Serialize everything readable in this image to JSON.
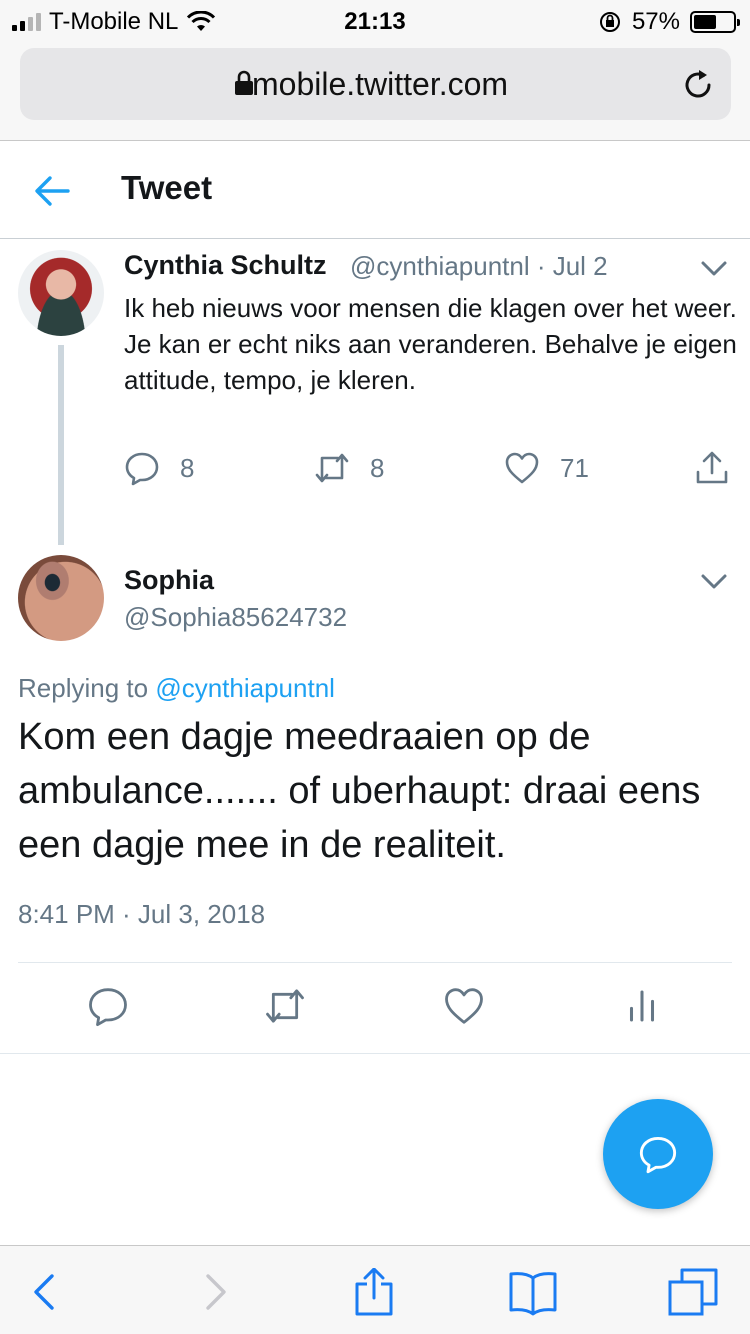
{
  "status_bar": {
    "carrier": "T-Mobile NL",
    "time": "21:13",
    "battery_percent": "57%",
    "battery_level": 0.57,
    "signal_bars": 4,
    "signal_bars_active": 2
  },
  "browser": {
    "url": "mobile.twitter.com"
  },
  "header": {
    "title": "Tweet"
  },
  "parent_tweet": {
    "author_name": "Cynthia Schultz",
    "handle_date": "@cynthiapuntnl · Jul 2",
    "text_line1": "Ik heb nieuws voor mensen die klagen over het weer.",
    "text_line2": "Je kan er echt niks aan veranderen.  Behalve je eigen attitude, tempo, je kleren.",
    "replies": "8",
    "retweets": "8",
    "likes": "71"
  },
  "main_tweet": {
    "author_name": "Sophia",
    "handle": "@Sophia85624732",
    "replying_prefix": "Replying to",
    "replying_mention": "@cynthiapuntnl",
    "text": "Kom een dagje meedraaien op de ambulance....... of uberhaupt: draai eens een dagje mee in de realiteit.",
    "timestamp": "8:41 PM · Jul 3, 2018"
  },
  "colors": {
    "accent": "#1da1f2",
    "secondary_text": "#657786",
    "primary_text": "#14171a"
  },
  "icons": {
    "back": "arrow-left-icon",
    "reply": "reply-icon",
    "retweet": "retweet-icon",
    "like": "heart-icon",
    "share": "share-icon",
    "analytics": "analytics-icon",
    "compose": "compose-reply-icon"
  }
}
